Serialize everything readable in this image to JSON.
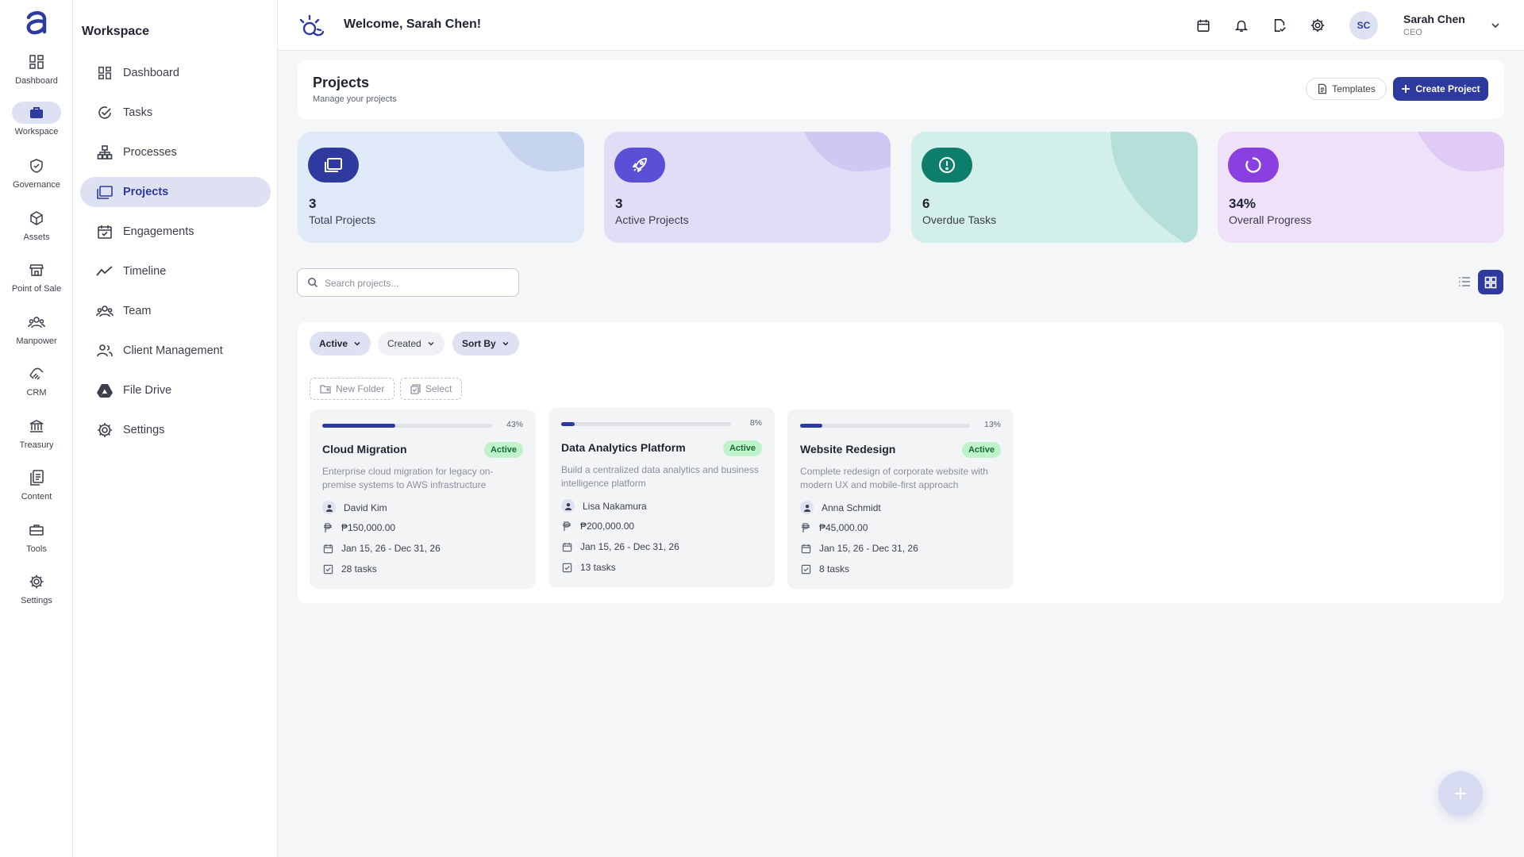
{
  "rail": {
    "items": [
      {
        "label": "Dashboard",
        "icon": "grid-icon"
      },
      {
        "label": "Workspace",
        "icon": "briefcase-icon",
        "active": true
      },
      {
        "label": "Governance",
        "icon": "shield-check-icon"
      },
      {
        "label": "Assets",
        "icon": "cube-icon"
      },
      {
        "label": "Point of Sale",
        "icon": "storefront-icon"
      },
      {
        "label": "Manpower",
        "icon": "people-icon"
      },
      {
        "label": "CRM",
        "icon": "handshake-icon"
      },
      {
        "label": "Treasury",
        "icon": "bank-icon"
      },
      {
        "label": "Content",
        "icon": "documents-icon"
      },
      {
        "label": "Tools",
        "icon": "toolbox-icon"
      },
      {
        "label": "Settings",
        "icon": "gear-icon"
      }
    ]
  },
  "sidebar": {
    "title": "Workspace",
    "items": [
      {
        "label": "Dashboard",
        "icon": "grid-icon"
      },
      {
        "label": "Tasks",
        "icon": "check-circle-icon"
      },
      {
        "label": "Processes",
        "icon": "hierarchy-icon"
      },
      {
        "label": "Projects",
        "icon": "folders-icon",
        "active": true
      },
      {
        "label": "Engagements",
        "icon": "calendar-check-icon"
      },
      {
        "label": "Timeline",
        "icon": "trend-line-icon"
      },
      {
        "label": "Team",
        "icon": "team-icon"
      },
      {
        "label": "Client Management",
        "icon": "client-icon"
      },
      {
        "label": "File Drive",
        "icon": "drive-icon"
      },
      {
        "label": "Settings",
        "icon": "gear-icon"
      }
    ]
  },
  "topbar": {
    "welcome": "Welcome, Sarah Chen!",
    "user_initials": "SC",
    "user_name": "Sarah Chen",
    "user_role": "CEO"
  },
  "header": {
    "title": "Projects",
    "subtitle": "Manage your projects",
    "templates_label": "Templates",
    "create_label": "Create Project"
  },
  "stats": [
    {
      "value": "3",
      "label": "Total Projects",
      "icon": "folders-icon",
      "bg": "#dfe9f7",
      "icon_bg": "#2f3a9e",
      "blob": "#c6d4ef"
    },
    {
      "value": "3",
      "label": "Active Projects",
      "icon": "rocket-icon",
      "bg": "#e2ddf7",
      "icon_bg": "#5b4fd6",
      "blob": "#d0c8f3"
    },
    {
      "value": "6",
      "label": "Overdue Tasks",
      "icon": "alert-circle-icon",
      "bg": "#d3efea",
      "icon_bg": "#0f7d6c",
      "blob": "#b5dfd8"
    },
    {
      "value": "34%",
      "label": "Overall Progress",
      "icon": "progress-ring-icon",
      "bg": "#efe1fa",
      "icon_bg": "#8a3fe0",
      "blob": "#e0cbf5"
    }
  ],
  "search": {
    "placeholder": "Search projects..."
  },
  "filters": {
    "status": "Active",
    "created": "Created",
    "sort": "Sort By"
  },
  "actions": {
    "new_folder": "New Folder",
    "select": "Select"
  },
  "projects": [
    {
      "progress": 43,
      "progress_label": "43%",
      "title": "Cloud Migration",
      "status": "Active",
      "description": "Enterprise cloud migration for legacy on-premise systems to AWS infrastructure",
      "owner": "David Kim",
      "budget": "₱150,000.00",
      "dates": "Jan 15, 26 - Dec 31, 26",
      "tasks": "28 tasks"
    },
    {
      "progress": 8,
      "progress_label": "8%",
      "title": "Data Analytics Platform",
      "status": "Active",
      "description": "Build a centralized data analytics and business intelligence platform",
      "owner": "Lisa Nakamura",
      "budget": "₱200,000.00",
      "dates": "Jan 15, 26 - Dec 31, 26",
      "tasks": "13 tasks"
    },
    {
      "progress": 13,
      "progress_label": "13%",
      "title": "Website Redesign",
      "status": "Active",
      "description": "Complete redesign of corporate website with modern UX and mobile-first approach",
      "owner": "Anna Schmidt",
      "budget": "₱45,000.00",
      "dates": "Jan 15, 26 - Dec 31, 26",
      "tasks": "8 tasks"
    }
  ]
}
